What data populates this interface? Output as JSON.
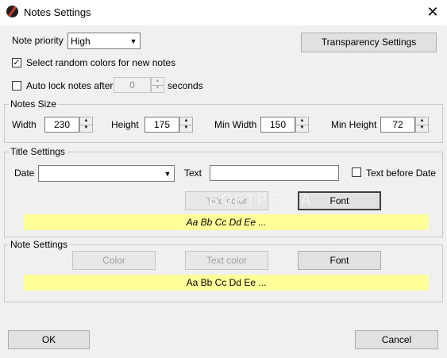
{
  "window": {
    "title": "Notes Settings",
    "close_glyph": "✕"
  },
  "priority": {
    "label": "Note priority",
    "value": "High"
  },
  "transparency_button": "Transparency Settings",
  "random_colors": {
    "label": "Select random colors for new notes",
    "checked": true
  },
  "auto_lock": {
    "label": "Auto lock notes after",
    "value": "0",
    "suffix": "seconds",
    "checked": false
  },
  "notes_size": {
    "title": "Notes Size",
    "width": {
      "label": "Width",
      "value": "230"
    },
    "height": {
      "label": "Height",
      "value": "175"
    },
    "min_width": {
      "label": "Min Width",
      "value": "150"
    },
    "min_height": {
      "label": "Min Height",
      "value": "72"
    }
  },
  "title_settings": {
    "title": "Title Settings",
    "date_label": "Date",
    "date_value": "",
    "text_label": "Text",
    "text_value": "",
    "text_before_date": "Text before Date",
    "title_color_button": "Title color",
    "font_button": "Font",
    "preview": "Aa Bb Cc Dd Ee ..."
  },
  "note_settings": {
    "title": "Note Settings",
    "color_button": "Color",
    "text_color_button": "Text color",
    "font_button": "Font",
    "preview": "Aa Bb Cc Dd Ee ..."
  },
  "watermark": "SOFTPEDIA",
  "ok_button": "OK",
  "cancel_button": "Cancel",
  "glyphs": {
    "check": "✓",
    "down": "▼",
    "up": "▲"
  },
  "colors": {
    "preview_bg": "#ffff99",
    "window_bg": "#f0f0f0",
    "disabled_text": "#a0a0a0"
  }
}
